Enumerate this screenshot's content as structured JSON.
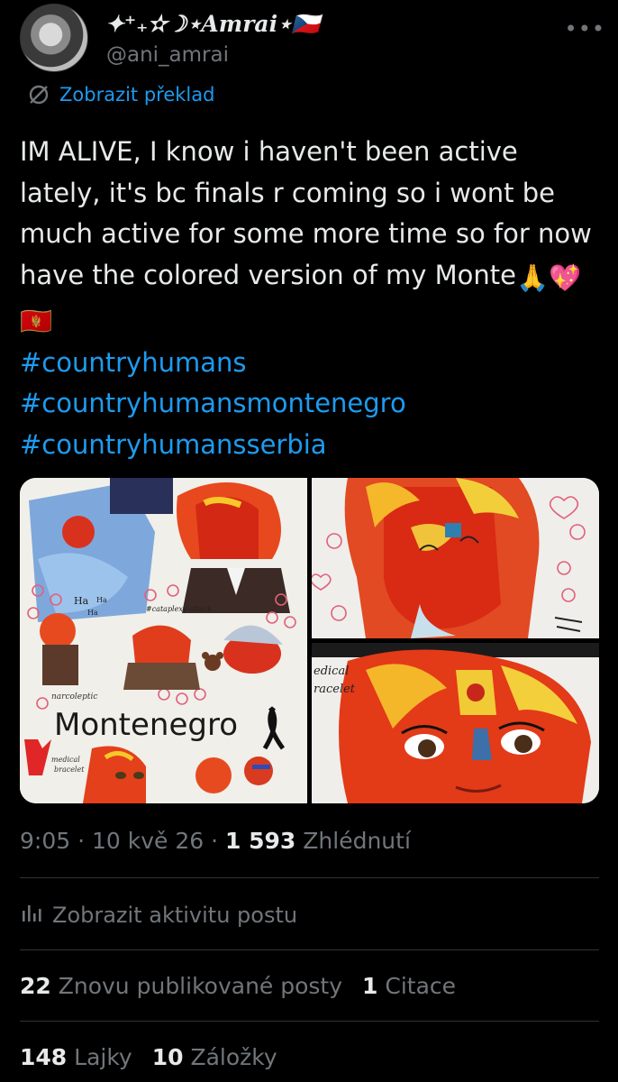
{
  "author": {
    "display_name": "✦⁺₊✫☽⋆Amrai⋆🇨🇿",
    "handle": "@ani_amrai",
    "avatar_icon": "avatar-drawing"
  },
  "more_label": "•••",
  "translate_label": "Zobrazit překlad",
  "tweet": {
    "text_line": "IM ALIVE, I know i haven't been active lately, it's bc finals r coming so i wont be much active for some more time so for now have the colored version of my Monte",
    "emojis": [
      "🙏",
      "💖",
      "🇲🇪"
    ],
    "hashtags": [
      "#countryhumans",
      "#countryhumansmontenegro",
      "#countryhumansserbia"
    ]
  },
  "media": {
    "image1_words": {
      "ha1": "Ha",
      "ha2": "Ha",
      "ha3": "Ha",
      "cataplexy": "#cataplexy attack",
      "narcoleptic": "narcoleptic",
      "montenegro": "Montenegro",
      "medical": "medical",
      "bracelet": "bracelet"
    },
    "image3_words": {
      "medical": "edical",
      "bracelet": "racelet"
    }
  },
  "meta": {
    "time": "9:05",
    "date": "10 kvě 26",
    "views_count": "1 593",
    "views_label": "Zhlédnutí",
    "separator": "·"
  },
  "activity_label": "Zobrazit aktivitu postu",
  "stats": {
    "reposts_count": "22",
    "reposts_label": "Znovu publikované posty",
    "quotes_count": "1",
    "quotes_label": "Citace",
    "likes_count": "148",
    "likes_label": "Lajky",
    "bookmarks_count": "10",
    "bookmarks_label": "Záložky"
  },
  "colors": {
    "background": "#000000",
    "text": "#e7e9ea",
    "secondary": "#71767b",
    "link": "#1d9bf0",
    "divider": "#2f3336"
  }
}
